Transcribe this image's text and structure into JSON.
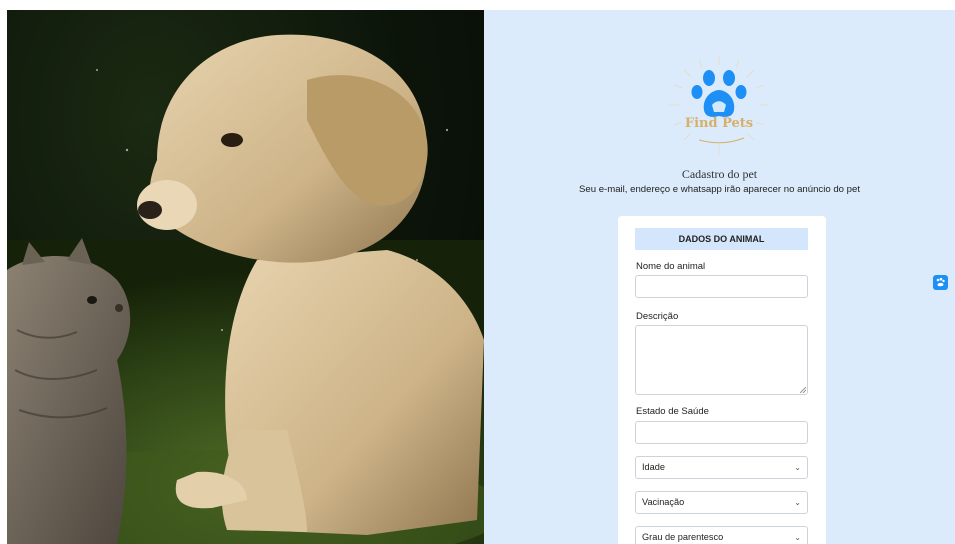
{
  "brand": {
    "logo_text": "Find Pets",
    "primary_color": "#1e8ff5",
    "logo_text_color": "#d4b06a"
  },
  "header": {
    "title": "Cadastro do pet",
    "subtitle": "Seu e-mail, endereço e whatsapp irão aparecer no anúncio do pet"
  },
  "form": {
    "section_title": "DADOS DO ANIMAL",
    "fields": {
      "name_label": "Nome do animal",
      "name_value": "",
      "description_label": "Descrição",
      "description_value": "",
      "health_label": "Estado de Saúde",
      "health_value": ""
    },
    "selects": {
      "age": "Idade",
      "vaccination": "Vacinação",
      "kinship": "Grau de parentesco"
    }
  },
  "icons": {
    "logo": "paw-icon",
    "side_button": "pet-icon",
    "select_arrow": "chevron-down-icon"
  }
}
